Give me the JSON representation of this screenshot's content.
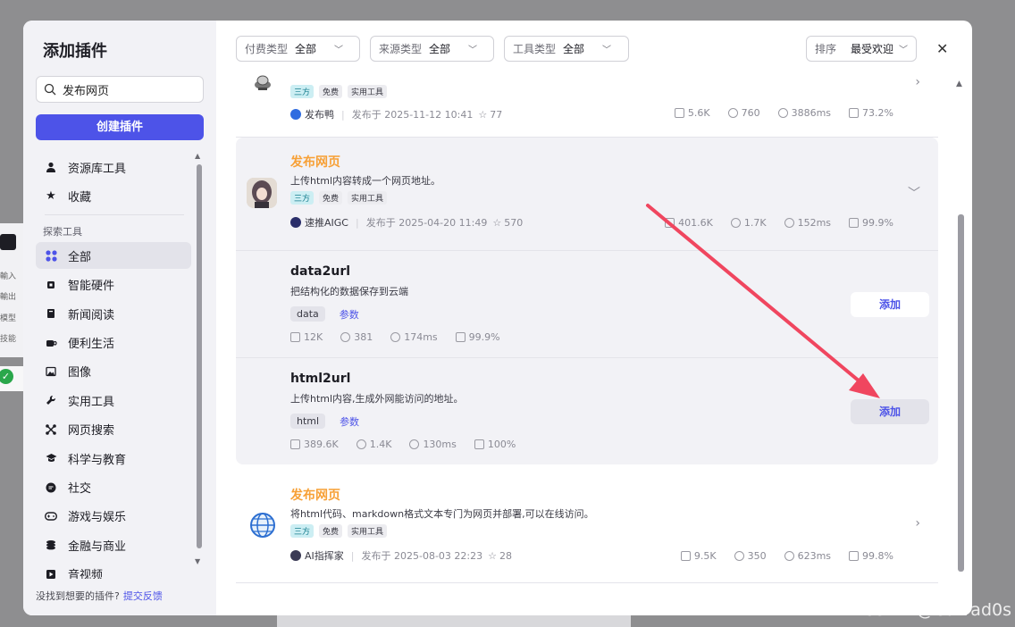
{
  "background": {
    "labels": [
      "輸入",
      "輸出",
      "模型",
      "技能"
    ]
  },
  "sidebar": {
    "title": "添加插件",
    "search_value": "发布网页",
    "create_label": "创建插件",
    "top_items": [
      {
        "label": "资源库工具",
        "icon": "user-icon"
      },
      {
        "label": "收藏",
        "icon": "star-icon"
      }
    ],
    "section_label": "探索工具",
    "items": [
      {
        "label": "全部",
        "icon": "grid-icon",
        "active": true
      },
      {
        "label": "智能硬件",
        "icon": "chip-icon"
      },
      {
        "label": "新闻阅读",
        "icon": "book-icon"
      },
      {
        "label": "便利生活",
        "icon": "cup-icon"
      },
      {
        "label": "图像",
        "icon": "image-icon"
      },
      {
        "label": "实用工具",
        "icon": "wrench-icon"
      },
      {
        "label": "网页搜索",
        "icon": "network-icon"
      },
      {
        "label": "科学与教育",
        "icon": "graduation-icon"
      },
      {
        "label": "社交",
        "icon": "chat-icon"
      },
      {
        "label": "游戏与娱乐",
        "icon": "gamepad-icon"
      },
      {
        "label": "金融与商业",
        "icon": "coins-icon"
      },
      {
        "label": "音视频",
        "icon": "media-icon"
      }
    ],
    "footer_text": "没找到想要的插件?",
    "footer_link": "提交反馈"
  },
  "toolbar": {
    "filters": [
      {
        "key": "付费类型",
        "value": "全部"
      },
      {
        "key": "来源类型",
        "value": "全部"
      },
      {
        "key": "工具类型",
        "value": "全部"
      }
    ],
    "sort_key": "排序",
    "sort_value": "最受欢迎"
  },
  "plugins": [
    {
      "tags": [
        "三方",
        "免费",
        "实用工具"
      ],
      "author": "发布鸭",
      "published": "发布于 2025-11-12 10:41",
      "stars": "77",
      "stats": [
        "5.6K",
        "760",
        "3886ms",
        "73.2%"
      ]
    },
    {
      "title": "发布网页",
      "desc": "上传html内容转成一个网页地址。",
      "tags": [
        "三方",
        "免费",
        "实用工具"
      ],
      "author": "速推AIGC",
      "published": "发布于 2025-04-20 11:49",
      "stars": "570",
      "stats": [
        "401.6K",
        "1.7K",
        "152ms",
        "99.9%"
      ],
      "tools": [
        {
          "name": "data2url",
          "desc": "把结构化的数据保存到云端",
          "param_tag": "data",
          "param_link": "参数",
          "stats": [
            "12K",
            "381",
            "174ms",
            "99.9%"
          ],
          "add_label": "添加"
        },
        {
          "name": "html2url",
          "desc": "上传html内容,生成外网能访问的地址。",
          "param_tag": "html",
          "param_link": "参数",
          "stats": [
            "389.6K",
            "1.4K",
            "130ms",
            "100%"
          ],
          "add_label": "添加"
        }
      ]
    },
    {
      "title": "发布网页",
      "desc": "将html代码、markdown格式文本专门为网页并部署,可以在线访问。",
      "tags": [
        "三方",
        "免费",
        "实用工具"
      ],
      "author": "AI指挥家",
      "published": "发布于 2025-08-03 22:23",
      "stars": "28",
      "stats": [
        "9.5K",
        "350",
        "623ms",
        "99.8%"
      ]
    }
  ],
  "watermark": "CSDN @Calvad0s",
  "colors": {
    "accent": "#4d53e8",
    "title_orange": "#f7a036",
    "arrow": "#f0465f"
  }
}
